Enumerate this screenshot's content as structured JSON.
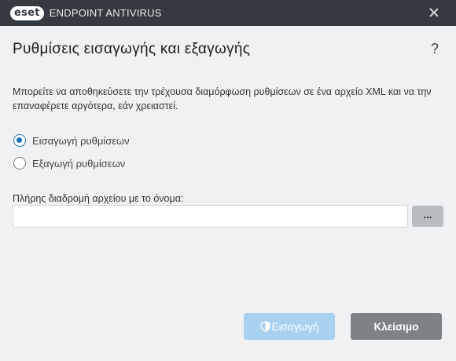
{
  "window": {
    "logo_text": "eset",
    "product_name": "ENDPOINT ANTIVIRUS"
  },
  "dialog": {
    "title": "Ρυθμίσεις εισαγωγής και εξαγωγής",
    "help_glyph": "?",
    "description": "Μπορείτε να αποθηκεύσετε την τρέχουσα διαμόρφωση ρυθμίσεων σε ένα αρχείο XML και να την επαναφέρετε αργότερα, εάν χρειαστεί.",
    "options": [
      {
        "label": "Εισαγωγή ρυθμίσεων",
        "selected": true
      },
      {
        "label": "Εξαγωγή ρυθμίσεων",
        "selected": false
      }
    ],
    "path_label": "Πλήρης διαδρομή αρχείου με το όνομα:",
    "path_value": "",
    "browse_label": "...",
    "import_button": "Εισαγωγή",
    "close_button": "Κλείσιμο"
  },
  "colors": {
    "titlebar": "#343a40",
    "accent": "#1a73b8",
    "import_button_disabled": "#a7d1ef",
    "close_button": "#7d8287"
  },
  "icons": [
    "close-icon",
    "help-icon",
    "shield-icon"
  ]
}
